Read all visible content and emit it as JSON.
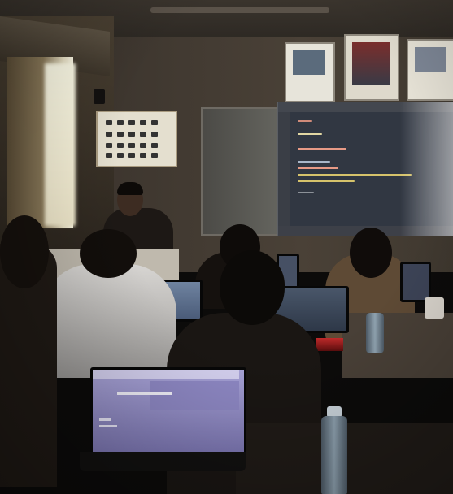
{
  "image": {
    "scene": "classroom",
    "colors": {
      "projection_screen": "#313742",
      "laptop_screen_main": "#a9a4d8",
      "room_dark": "#0c0b0a"
    }
  }
}
